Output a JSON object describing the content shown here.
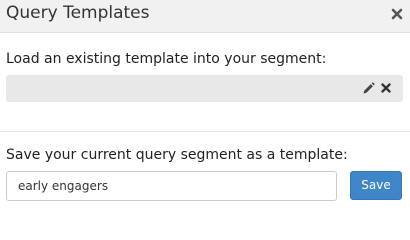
{
  "dialog": {
    "title": "Query Templates",
    "close_icon": "close-icon"
  },
  "load_section": {
    "label": "Load an existing template into your segment:",
    "selected_template": "",
    "edit_icon": "pencil-icon",
    "remove_icon": "remove-icon"
  },
  "save_section": {
    "label": "Save your current query segment as a template:",
    "template_name_value": "early engagers",
    "save_label": "Save"
  },
  "colors": {
    "header_background": "#f1f1f1",
    "select_background": "#e8e8e8",
    "primary_button": "#3f86c8",
    "icon": "#555555"
  }
}
